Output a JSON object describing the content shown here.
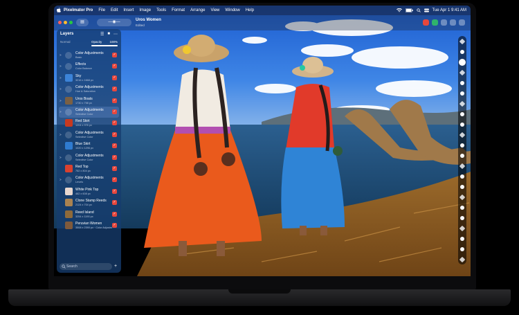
{
  "menubar": {
    "apple": "",
    "app_name": "Pixelmator Pro",
    "items": [
      "File",
      "Edit",
      "Insert",
      "Image",
      "Tools",
      "Format",
      "Arrange",
      "View",
      "Window",
      "Help"
    ],
    "clock": "Tue Apr 1  9:41 AM"
  },
  "document": {
    "title": "Uros Women",
    "subtitle": "Edited"
  },
  "layers_panel": {
    "title": "Layers",
    "blend_mode": "Normal",
    "opacity_label": "Opacity",
    "opacity_value": "100%",
    "opacity_fraction": 1.0,
    "search_placeholder": "Search",
    "add_label": "+",
    "items": [
      {
        "name": "Color Adjustments",
        "meta": "Basic",
        "type": "adjustment",
        "chevron": ">"
      },
      {
        "name": "Effects",
        "meta": "Color Balance",
        "type": "adjustment",
        "chevron": ">"
      },
      {
        "name": "Sky",
        "meta": "3216 x 1668 px",
        "type": "image",
        "chevron": ">"
      },
      {
        "name": "Color Adjustments",
        "meta": "Hue & Saturation",
        "type": "adjustment",
        "chevron": ">"
      },
      {
        "name": "Uros Boats",
        "meta": "1730 x 798 px",
        "type": "image",
        "chevron": ">"
      },
      {
        "name": "Color Adjustments",
        "meta": "Selective Color",
        "type": "adjustment",
        "chevron": ">",
        "selected": true
      },
      {
        "name": "Red Skirt",
        "meta": "1204 x 976 px",
        "type": "image",
        "chevron": ""
      },
      {
        "name": "Color Adjustments",
        "meta": "Selective Color",
        "type": "adjustment",
        "chevron": ">"
      },
      {
        "name": "Blue Skirt",
        "meta": "1020 x 1296 px",
        "type": "image",
        "chevron": ""
      },
      {
        "name": "Color Adjustments",
        "meta": "Selective Color",
        "type": "adjustment",
        "chevron": ">"
      },
      {
        "name": "Red Top",
        "meta": "752 x 804 px",
        "type": "image",
        "chevron": ""
      },
      {
        "name": "Color Adjustments",
        "meta": "Levels",
        "type": "adjustment",
        "chevron": ">"
      },
      {
        "name": "White Pink Top",
        "meta": "462 x 608 px",
        "type": "image",
        "chevron": ""
      },
      {
        "name": "Clone Stamp Reeds",
        "meta": "2124 x 704 px",
        "type": "image",
        "chevron": ""
      },
      {
        "name": "Reed Island",
        "meta": "3254 x 1190 px",
        "type": "image",
        "chevron": ""
      },
      {
        "name": "Peruvian Women",
        "meta": "3508 x 2390 px · Color Adjustm",
        "type": "image",
        "chevron": ""
      }
    ]
  },
  "colors": {
    "accent": "#1f6fd6",
    "visibility_check": "#e8473d",
    "traffic_close": "#ff5f57",
    "traffic_min": "#febc2e",
    "traffic_max": "#28c840"
  },
  "icons": [
    "apple-logo-icon",
    "wifi-icon",
    "battery-icon",
    "search-icon",
    "control-center-icon",
    "sidebar-icon",
    "zoom-icon",
    "share-icon",
    "panel-icon",
    "move-tool-icon",
    "selection-tool-icon",
    "brush-tool-icon",
    "add-layer-icon"
  ]
}
